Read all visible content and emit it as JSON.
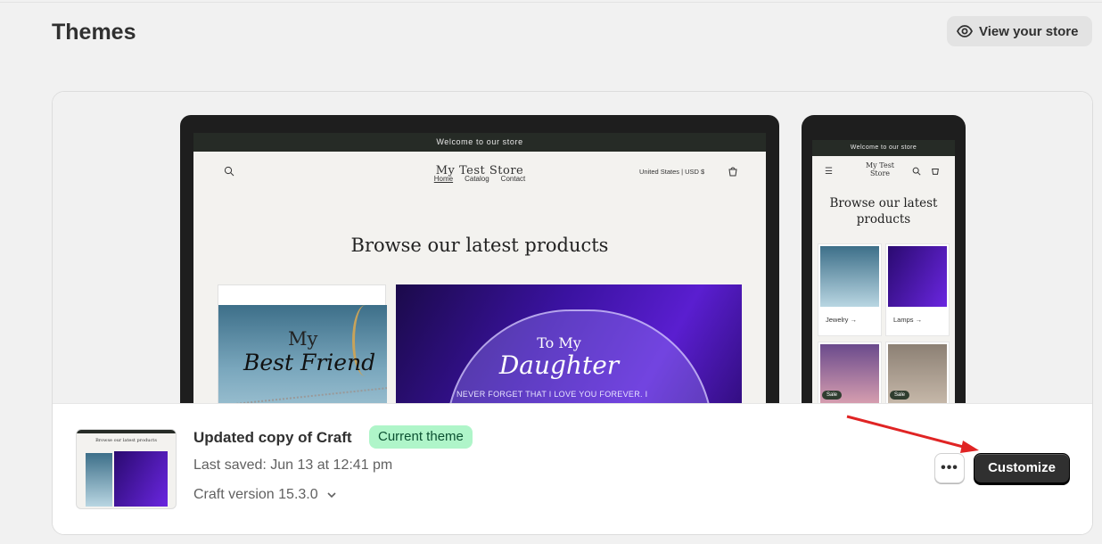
{
  "page": {
    "title": "Themes",
    "view_store_label": "View your store"
  },
  "preview": {
    "announcement": "Welcome to our store",
    "store_name": "My Test Store",
    "currency": "United States | USD $",
    "nav": [
      "Home",
      "Catalog",
      "Contact"
    ],
    "heading": "Browse our latest products",
    "product1": {
      "line1": "My",
      "line2": "Best Friend"
    },
    "product2": {
      "line1": "To My",
      "line2": "Daughter",
      "message": "NEVER FORGET THAT I LOVE YOU FOREVER. I HOPE THAT YOU BELIEVE"
    },
    "mobile": {
      "announcement": "Welcome to our store",
      "store_name": "My Test Store",
      "heading": "Browse our latest products",
      "collections": [
        "Jewelry →",
        "Lamps →"
      ],
      "sale_label": "Sale"
    }
  },
  "theme": {
    "name": "Updated copy of Craft",
    "badge": "Current theme",
    "last_saved": "Last saved: Jun 13 at 12:41 pm",
    "version": "Craft version 15.3.0",
    "thumb_heading": "Browse our latest products"
  },
  "actions": {
    "more_label": "•••",
    "customize_label": "Customize"
  },
  "colors": {
    "badge_bg": "#aff5c9",
    "primary_button": "#303030",
    "annotation_arrow": "#e02424"
  }
}
